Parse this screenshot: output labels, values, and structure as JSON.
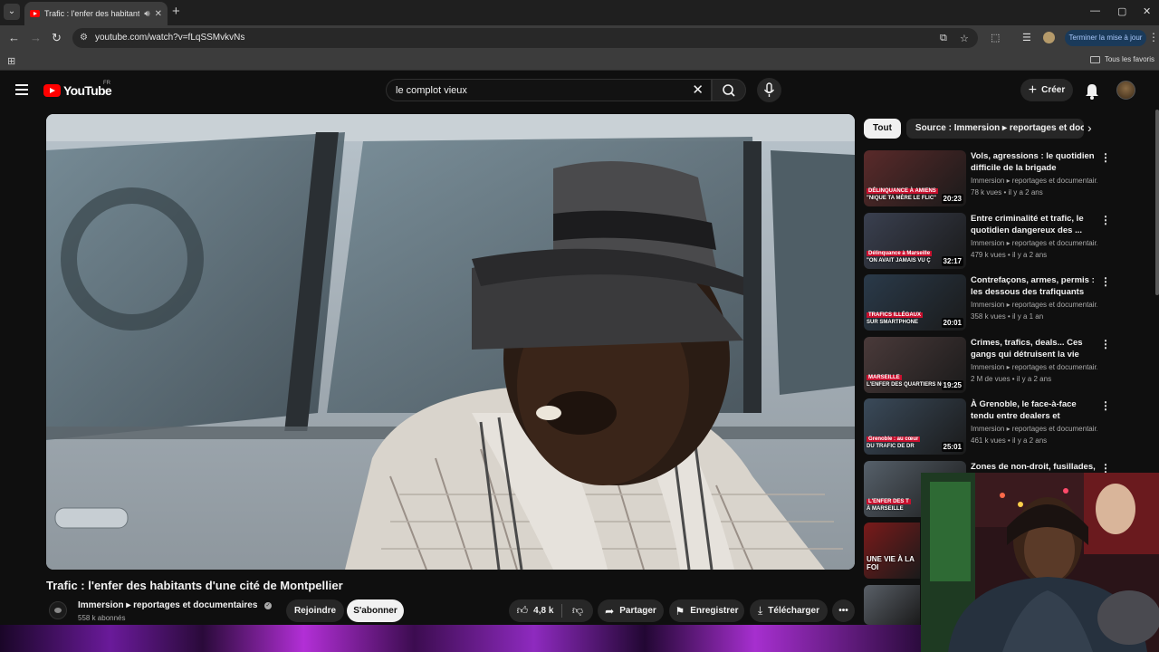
{
  "browser": {
    "tab_title": "Trafic : l'enfer des habitants d'une cité de Montpellier",
    "url": "youtube.com/watch?v=fLqSSMvkvNs",
    "update_label": "Terminer la mise à jour",
    "bookmarks_label": "Tous les favoris"
  },
  "youtube": {
    "logo_text": "YouTube",
    "country": "FR",
    "search_value": "le complot vieux",
    "create_label": "Créer"
  },
  "video": {
    "title": "Trafic : l'enfer des habitants d'une cité de Montpellier",
    "channel": "Immersion ▸ reportages et documentaires",
    "subscribers": "558 k abonnés",
    "join_label": "Rejoindre",
    "subscribe_label": "S'abonner",
    "likes": "4,8 k",
    "share_label": "Partager",
    "save_label": "Enregistrer",
    "download_label": "Télécharger"
  },
  "sidebar": {
    "chips": [
      "Tout",
      "Source : Immersion ▸ reportages et documentaires"
    ],
    "recommendations": [
      {
        "title": "Vols, agressions : le quotidien difficile de la brigade nocturne...",
        "channel": "Immersion ▸ reportages et documentair...",
        "meta": "78 k vues • il y a 2 ans",
        "duration": "20:23",
        "thumb_tag": "DÉLINQUANCE À AMIENS",
        "thumb_caption": "\"NIQUE TA MÈRE LE FLIC\"",
        "thumb_color": "#5a2a2a"
      },
      {
        "title": "Entre criminalité et trafic, le quotidien dangereux des ...",
        "channel": "Immersion ▸ reportages et documentair...",
        "meta": "479 k vues • il y a 2 ans",
        "duration": "32:17",
        "thumb_tag": "Délinquance à Marseille",
        "thumb_caption": "\"ON AVAIT JAMAIS VU Ç",
        "thumb_color": "#3a4050"
      },
      {
        "title": "Contrefaçons, armes, permis : les dessous des trafiquants",
        "channel": "Immersion ▸ reportages et documentair...",
        "meta": "358 k vues • il y a 1 an",
        "duration": "20:01",
        "thumb_tag": "TRAFICS ILLÉGAUX",
        "thumb_caption": "SUR SMARTPHONE",
        "thumb_color": "#2a3a4a"
      },
      {
        "title": "Crimes, trafics, deals... Ces gangs qui détruisent la vie des...",
        "channel": "Immersion ▸ reportages et documentair...",
        "meta": "2 M de vues • il y a 2 ans",
        "duration": "19:25",
        "thumb_tag": "MARSEILLE",
        "thumb_caption": "L'ENFER DES QUARTIERS NO",
        "thumb_color": "#4a3a3a"
      },
      {
        "title": "À Grenoble, le face-à-face tendu entre dealers et policiers",
        "channel": "Immersion ▸ reportages et documentair...",
        "meta": "461 k vues • il y a 2 ans",
        "duration": "25:01",
        "thumb_tag": "Grenoble : au cœur",
        "thumb_caption": "DU TRAFIC DE DR",
        "thumb_color": "#3a4a5a"
      },
      {
        "title": "Zones de non-droit, fusillades,",
        "channel": "",
        "meta": "",
        "duration": "",
        "thumb_tag": "L'ENFER DES T",
        "thumb_caption": "À MARSEILLE",
        "thumb_color": "#56606a"
      }
    ],
    "partial_thumbs": [
      {
        "caption": "UNE VIE À LA FOI",
        "color": "#7a1a1a"
      },
      {
        "caption": "",
        "color": "#5a6068"
      }
    ]
  },
  "colors": {
    "background": "#0f0f0f",
    "accent_red": "#ff0000",
    "chip_bg": "#272727",
    "text_secondary": "#aaaaaa"
  }
}
